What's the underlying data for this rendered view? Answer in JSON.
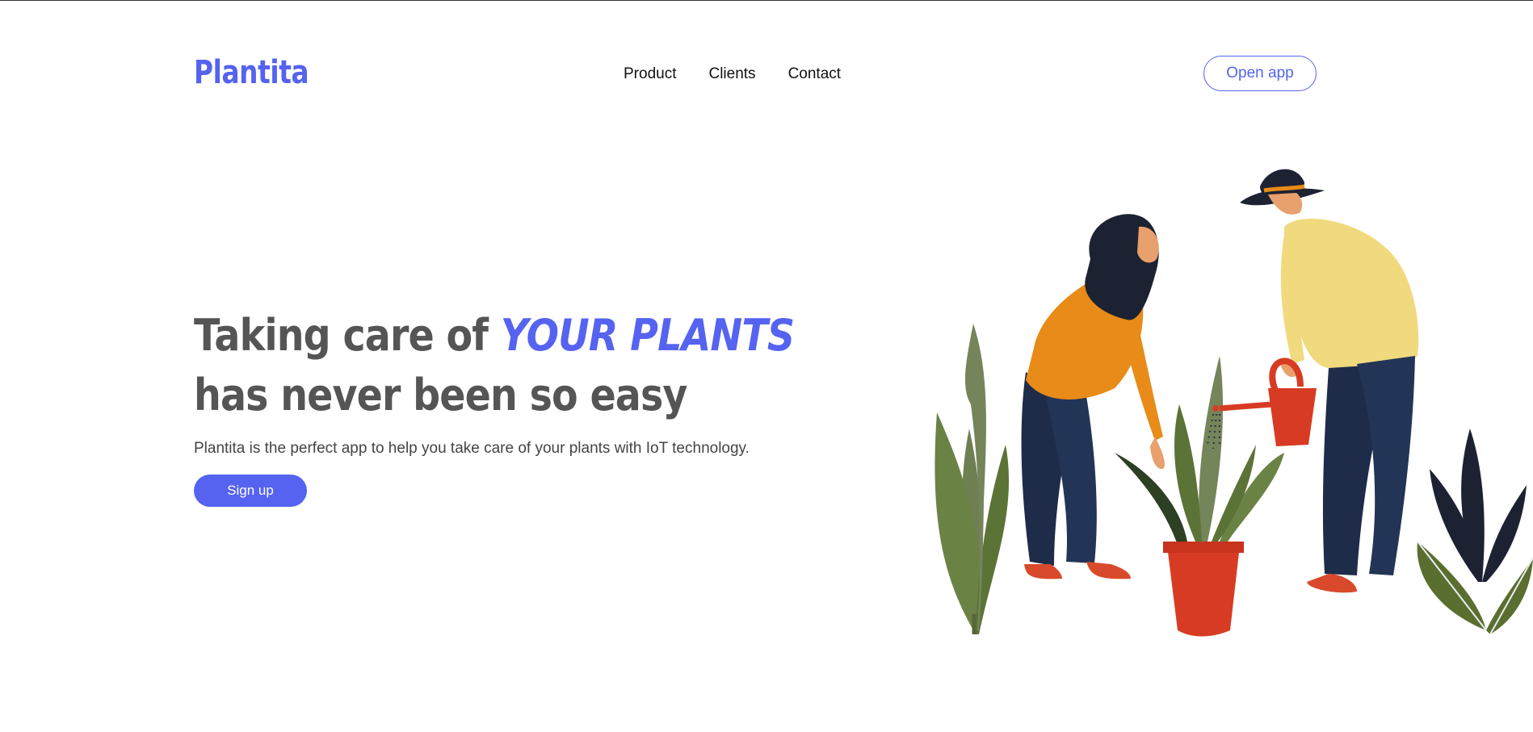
{
  "brand": {
    "name": "Plantita",
    "color": "#5563f0"
  },
  "nav": {
    "items": [
      "Product",
      "Clients",
      "Contact"
    ]
  },
  "header": {
    "open_app_label": "Open app"
  },
  "hero": {
    "headline_part1": "Taking care of ",
    "headline_accent": "YOUR PLANTS",
    "headline_part2": " has never been so easy",
    "subtitle": "Plantita is the perfect app to help you take care of your plants with IoT technology.",
    "signup_label": "Sign up"
  },
  "colors": {
    "accent": "#5563f0",
    "heading": "#555555",
    "text": "#444444"
  },
  "illustration": {
    "subject": "two-people-watering-plants"
  }
}
